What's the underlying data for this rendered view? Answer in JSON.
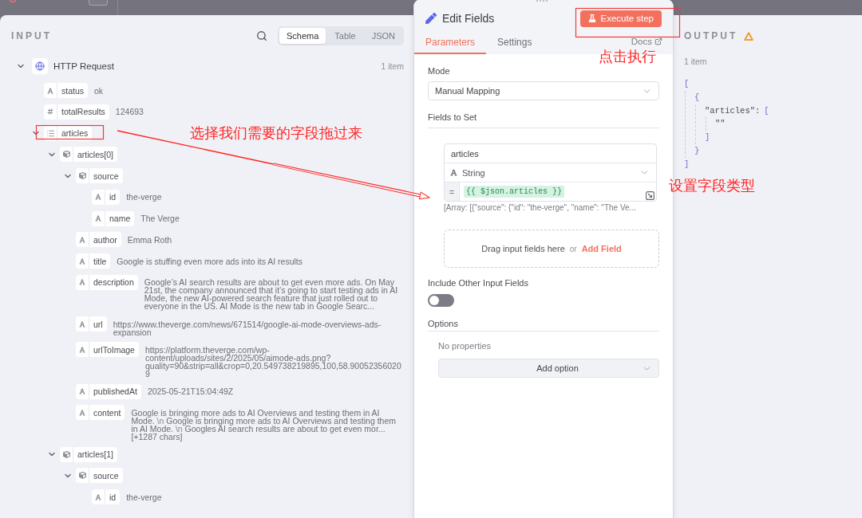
{
  "input_panel": {
    "title": "INPUT",
    "view_tabs": [
      {
        "label": "Schema",
        "selected": true
      },
      {
        "label": "Table",
        "selected": false
      },
      {
        "label": "JSON",
        "selected": false
      }
    ],
    "source": {
      "name": "HTTP Request",
      "count": "1 item",
      "expanded": true,
      "fields": [
        {
          "kind": "string",
          "name": "status",
          "value": "ok"
        },
        {
          "kind": "number",
          "name": "totalResults",
          "value": "124693"
        },
        {
          "kind": "array",
          "name": "articles",
          "expanded": true,
          "children": [
            {
              "kind": "object",
              "name": "articles[0]",
              "expanded": true,
              "children": [
                {
                  "kind": "object",
                  "name": "source",
                  "expanded": true,
                  "children": [
                    {
                      "kind": "string",
                      "name": "id",
                      "value": "the-verge"
                    },
                    {
                      "kind": "string",
                      "name": "name",
                      "value": "The Verge"
                    }
                  ]
                },
                {
                  "kind": "string",
                  "name": "author",
                  "value": "Emma Roth"
                },
                {
                  "kind": "string",
                  "name": "title",
                  "value": "Google is stuffing even more ads into its AI results"
                },
                {
                  "kind": "string",
                  "name": "description",
                  "value": "Google’s AI search results are about to get even more ads. On May 21st, the company announced that it’s going to start testing ads in AI Mode, the new AI-powered search feature that just rolled out to everyone in the US. AI Mode is the new tab in Google Searc..."
                },
                {
                  "kind": "string",
                  "name": "url",
                  "value": "https://www.theverge.com/news/671514/google-ai-mode-overviews-ads-expansion"
                },
                {
                  "kind": "string",
                  "name": "urlToImage",
                  "value": "https://platform.theverge.com/wp-content/uploads/sites/2/2025/05/aimode-ads.png?quality=90&strip=all&crop=0,20.549738219895,100,58.900523560209"
                },
                {
                  "kind": "string",
                  "name": "publishedAt",
                  "value": "2025-05-21T15:04:49Z"
                },
                {
                  "kind": "string",
                  "name": "content",
                  "value_parts": [
                    {
                      "kind": "text",
                      "text": "Google is bringing more ads to AI Overviews and testing them in AI Mode. "
                    },
                    {
                      "kind": "escape",
                      "text": "\\n"
                    },
                    {
                      "kind": "text",
                      "text": " Google is bringing more ads to AI Overviews and testing them in AI Mode. "
                    },
                    {
                      "kind": "escape",
                      "text": "\\n"
                    },
                    {
                      "kind": "text",
                      "text": " Googles AI search results are about to get even mor... [+1287 chars]"
                    }
                  ]
                }
              ]
            },
            {
              "kind": "object",
              "name": "articles[1]",
              "expanded": true,
              "children": [
                {
                  "kind": "object",
                  "name": "source",
                  "expanded": true,
                  "children": [
                    {
                      "kind": "string",
                      "name": "id",
                      "value": "the-verge"
                    }
                  ]
                }
              ]
            }
          ]
        }
      ]
    }
  },
  "editor": {
    "title": "Edit Fields",
    "execute_button": "Execute step",
    "tabs": [
      {
        "label": "Parameters",
        "selected": true
      },
      {
        "label": "Settings",
        "selected": false
      }
    ],
    "docs_link": "Docs",
    "mode": {
      "label": "Mode",
      "value": "Manual Mapping"
    },
    "fields_to_set": {
      "label": "Fields to Set",
      "assignments": [
        {
          "name": "articles",
          "type": "String",
          "prefix": "=",
          "value": "{{ $json.articles }}",
          "preview": "[Array: [{\"source\": {\"id\": \"the-verge\", \"name\": \"The Ve..."
        }
      ],
      "drop_hint": "Drag input fields here",
      "separator": "or",
      "add_field": "Add Field"
    },
    "include_other": {
      "label": "Include Other Input Fields",
      "on": false
    },
    "options": {
      "label": "Options",
      "empty": "No properties",
      "add_option": "Add option"
    }
  },
  "output_panel": {
    "title": "OUTPUT",
    "warning": true,
    "count": "1 item",
    "json": {
      "open": "[",
      "close": "]",
      "children": [
        {
          "open": "{",
          "close": "}",
          "children": [
            {
              "key": "\"articles\":",
              "open": "[",
              "close": "]",
              "children": [
                {
                  "value": "\"\""
                }
              ]
            }
          ]
        }
      ]
    }
  },
  "annotations": [
    {
      "text": "选择我们需要的字段拖过来"
    },
    {
      "text": "点击执行"
    },
    {
      "text": "设置字段类型"
    }
  ]
}
